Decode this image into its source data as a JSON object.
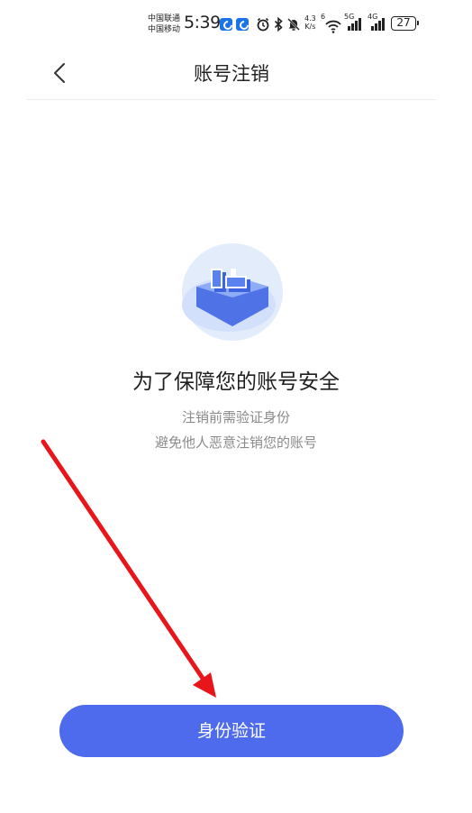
{
  "status_bar": {
    "carrier_1": "中国联通",
    "carrier_2": "中国移动",
    "time": "5:39",
    "speed_value": "4.3",
    "speed_unit": "K/s",
    "wifi_label": "6",
    "network_1": "5G",
    "network_2": "4G",
    "battery": "27"
  },
  "nav": {
    "title": "账号注销"
  },
  "content": {
    "heading": "为了保障您的账号安全",
    "line_1": "注销前需验证身份",
    "line_2": "避免他人恶意注销您的账号"
  },
  "actions": {
    "verify_label": "身份验证"
  },
  "colors": {
    "accent": "#4f6bed",
    "annotation": "#e8161b",
    "shield_light": "#e3ecfb",
    "shield": "#5a82ee"
  },
  "icons": {
    "back": "chevron-left-icon",
    "alarm": "alarm-icon",
    "bluetooth": "bluetooth-icon",
    "mute": "bell-muted-icon",
    "wifi": "wifi-icon",
    "illustration": "shield-lock-illustration"
  }
}
